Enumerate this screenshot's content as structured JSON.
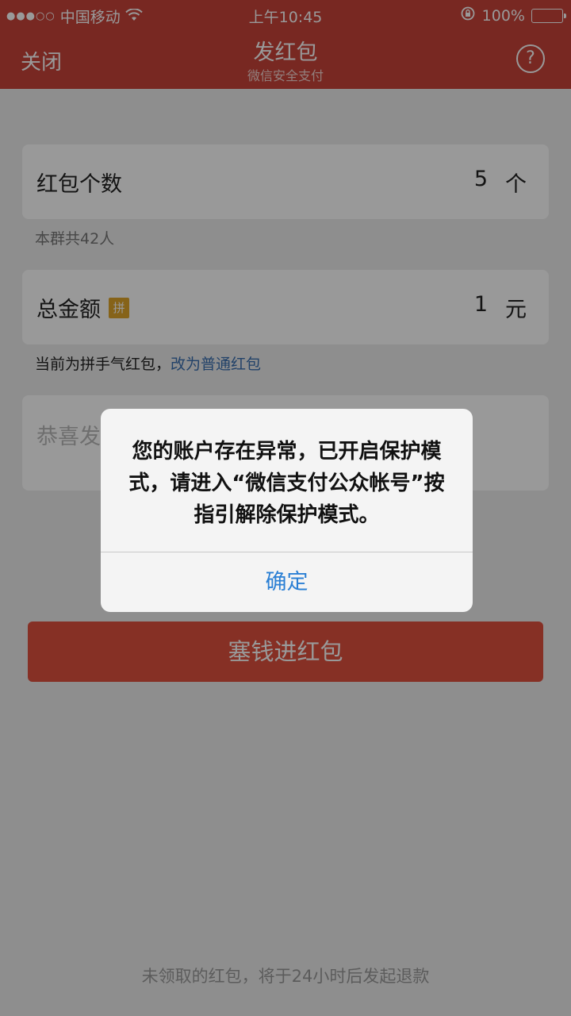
{
  "status_bar": {
    "carrier": "中国移动",
    "time": "上午10:45",
    "battery": "100%"
  },
  "nav": {
    "close_label": "关闭",
    "title": "发红包",
    "subtitle": "微信安全支付",
    "help_label": "?"
  },
  "form": {
    "count_label": "红包个数",
    "count_value": "5",
    "count_unit": "个",
    "group_hint": "本群共42人",
    "amount_label": "总金额",
    "amount_badge": "拼",
    "amount_value": "1",
    "amount_unit": "元",
    "mode_hint": "当前为拼手气红包，",
    "mode_link": "改为普通红包",
    "greeting_placeholder": "恭喜发",
    "send_button": "塞钱进红包",
    "footnote": "未领取的红包，将于24小时后发起退款"
  },
  "alert": {
    "message": "您的账户存在异常，已开启保护模式，请进入“微信支付公众帐号”按指引解除保护模式。",
    "ok_label": "确定"
  },
  "colors": {
    "brand_red": "#c8443a",
    "button_red": "#e0513f",
    "link_blue": "#3a6fb0",
    "alert_button_blue": "#2a7fd4"
  }
}
